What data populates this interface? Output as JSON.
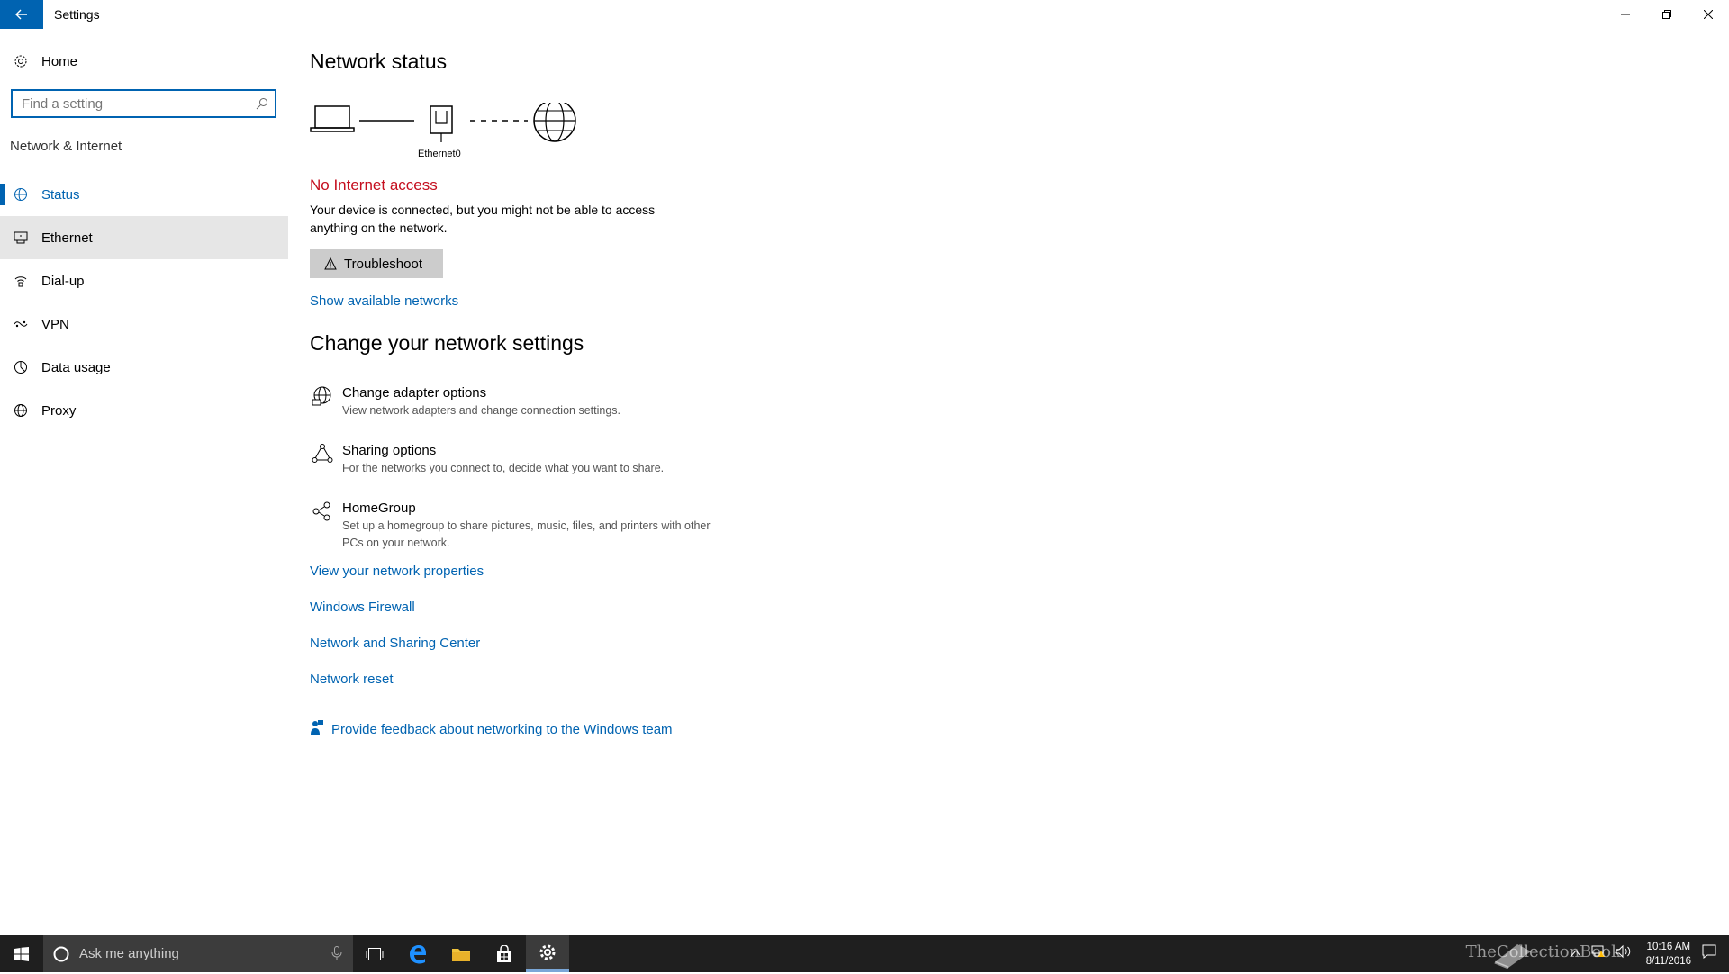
{
  "window": {
    "title": "Settings"
  },
  "sidebar": {
    "home_label": "Home",
    "search_placeholder": "Find a setting",
    "section_title": "Network & Internet",
    "items": [
      {
        "label": "Status",
        "icon": "status-icon"
      },
      {
        "label": "Ethernet",
        "icon": "ethernet-icon"
      },
      {
        "label": "Dial-up",
        "icon": "dialup-icon"
      },
      {
        "label": "VPN",
        "icon": "vpn-icon"
      },
      {
        "label": "Data usage",
        "icon": "data-usage-icon"
      },
      {
        "label": "Proxy",
        "icon": "globe-icon"
      }
    ]
  },
  "main": {
    "network_status_title": "Network status",
    "diagram_caption": "Ethernet0",
    "status_heading": "No Internet access",
    "status_description": "Your device is connected, but you might not be able to access anything on the network.",
    "troubleshoot_label": "Troubleshoot",
    "show_networks_link": "Show available networks",
    "change_title": "Change your network settings",
    "options": [
      {
        "title": "Change adapter options",
        "desc": "View network adapters and change connection settings.",
        "icon": "adapter-globe-icon"
      },
      {
        "title": "Sharing options",
        "desc": "For the networks you connect to, decide what you want to share.",
        "icon": "sharing-icon"
      },
      {
        "title": "HomeGroup",
        "desc": "Set up a homegroup to share pictures, music, files, and printers with other PCs on your network.",
        "icon": "homegroup-icon"
      }
    ],
    "links": [
      "View your network properties",
      "Windows Firewall",
      "Network and Sharing Center",
      "Network reset"
    ],
    "feedback_label": "Provide feedback about networking to the Windows team"
  },
  "taskbar": {
    "search_placeholder": "Ask me anything",
    "time": "10:16 AM",
    "date": "8/11/2016",
    "watermark": "TheCollectionBook"
  },
  "colors": {
    "accent": "#0063b1",
    "error": "#c50f1f",
    "taskbar": "#1f1f1f"
  }
}
